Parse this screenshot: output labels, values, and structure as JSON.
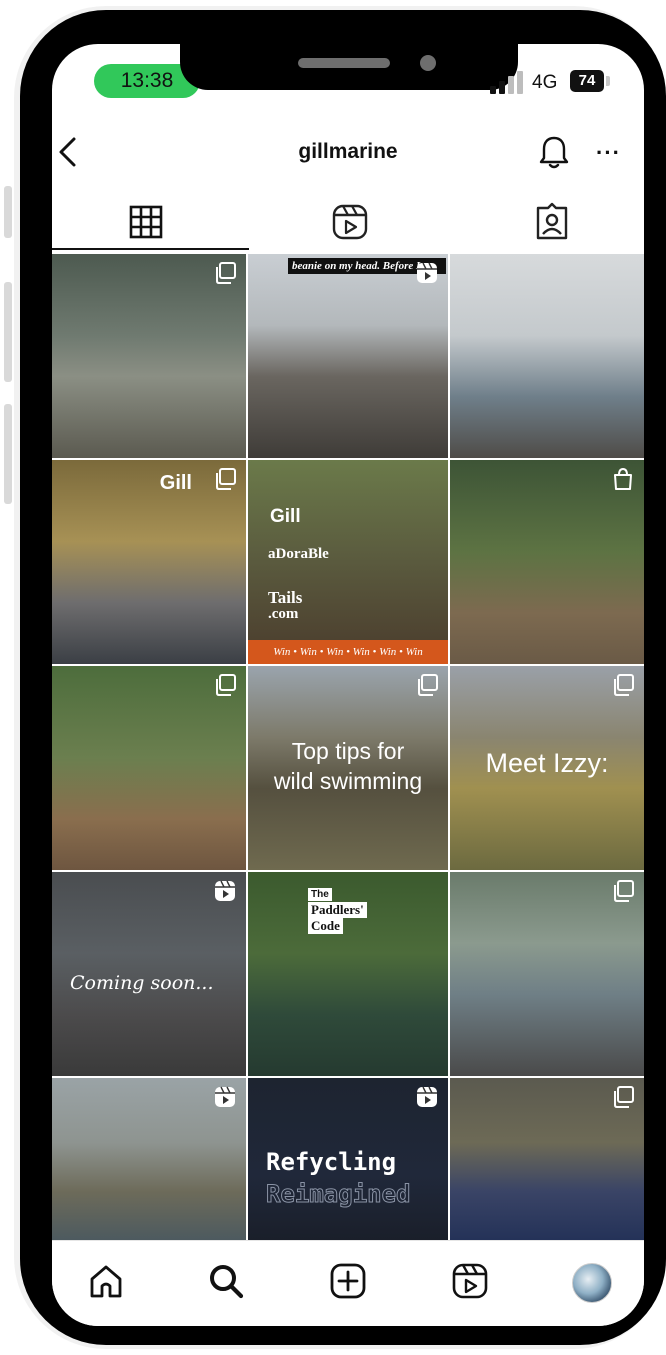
{
  "status_bar": {
    "time": "13:38",
    "network": "4G",
    "battery": "74"
  },
  "header": {
    "username": "gillmarine"
  },
  "tabs": [
    {
      "name": "posts-grid",
      "icon": "grid-icon",
      "active": true
    },
    {
      "name": "reels",
      "icon": "reels-icon",
      "active": false
    },
    {
      "name": "tagged",
      "icon": "tagged-user-icon",
      "active": false
    }
  ],
  "posts": [
    {
      "bg": "linear-gradient(180deg,#4d5a50 0%,#6f7a70 40%,#8b8f84 60%,#5b5a50 100%)",
      "badge": "carousel-icon"
    },
    {
      "bg": "linear-gradient(180deg,#c9ced3 0%,#b3b8bb 35%,#6a6660 60%,#3f3c38 100%)",
      "badge": "reel-icon",
      "banner": "beanie on my head. Before I go"
    },
    {
      "bg": "linear-gradient(180deg,#d7dadc 0%,#c4c9cc 40%,#6f7f8a 70%,#4f4c48 100%)"
    },
    {
      "bg": "linear-gradient(180deg,#7b6a3b 0%,#a79155 40%,#6e6d6e 70%,#3b3f45 100%)",
      "badge": "carousel-icon",
      "overlay": "Gill"
    },
    {
      "bg": "linear-gradient(180deg,#6b7a4a 0%,#5a5a3e 50%,#4a3b2c 100%)",
      "logo": "Gill",
      "lines": [
        "aDoraBle",
        "Tails",
        ".com"
      ],
      "strip": "Win • Win • Win • Win • Win • Win"
    },
    {
      "bg": "linear-gradient(180deg,#3d5436 0%,#5d7343 45%,#7d6a50 75%,#6a5a46 100%)",
      "badge": "shopping-bag-icon"
    },
    {
      "bg": "linear-gradient(180deg,#4d6d3c 0%,#6b7f4f 45%,#8a6e4e 75%,#6e5640 100%)",
      "badge": "carousel-icon"
    },
    {
      "bg": "linear-gradient(180deg,#9aa4ad 0%,#7d7a6a 35%,#55503f 60%,#6f6a4f 100%)",
      "badge": "carousel-icon",
      "lines": [
        "Top tips for",
        "wild swimming"
      ]
    },
    {
      "bg": "linear-gradient(180deg,#9aa0a8 0%,#8a8570 35%,#a09050 60%,#6c6a40 100%)",
      "badge": "carousel-icon",
      "lines": [
        "Meet Izzy:"
      ]
    },
    {
      "bg": "linear-gradient(180deg,#4a4d50 0%,#5a5f63 40%,#4c4b4c 70%,#3a3a3a 100%)",
      "badge": "reel-icon",
      "lines": [
        "Coming  soon..."
      ]
    },
    {
      "bg": "linear-gradient(180deg,#3b5a2e 0%,#4c6b3a 40%,#2f4a3a 70%,#253a30 100%)",
      "logo": "The",
      "lines": [
        "Paddlers'",
        "Code"
      ]
    },
    {
      "bg": "linear-gradient(180deg,#6a7b6b 0%,#8b9a8e 35%,#6f7f86 60%,#4a4a4a 100%)",
      "badge": "carousel-icon"
    },
    {
      "bg": "linear-gradient(180deg,#9aa3a6 0%,#8e9490 40%,#6d6b5a 70%,#4d5a5f 100%)",
      "badge": "reel-icon"
    },
    {
      "bg": "linear-gradient(180deg,#1d2430 0%,#20283a 60%,#1a1f2a 100%)",
      "badge": "reel-icon",
      "lines": [
        "Refycling",
        "Reimagined"
      ]
    },
    {
      "bg": "linear-gradient(180deg,#5b5a4f 0%,#6d6a56 40%,#3a4466 70%,#243258 100%)",
      "badge": "carousel-icon"
    }
  ],
  "bottom_nav": [
    {
      "name": "home",
      "icon": "home-icon"
    },
    {
      "name": "search",
      "icon": "search-icon"
    },
    {
      "name": "create",
      "icon": "plus-square-icon"
    },
    {
      "name": "reels",
      "icon": "reels-icon"
    },
    {
      "name": "profile",
      "icon": "avatar"
    }
  ],
  "colors": {
    "status_pill": "#31c85a",
    "text": "#111111"
  }
}
